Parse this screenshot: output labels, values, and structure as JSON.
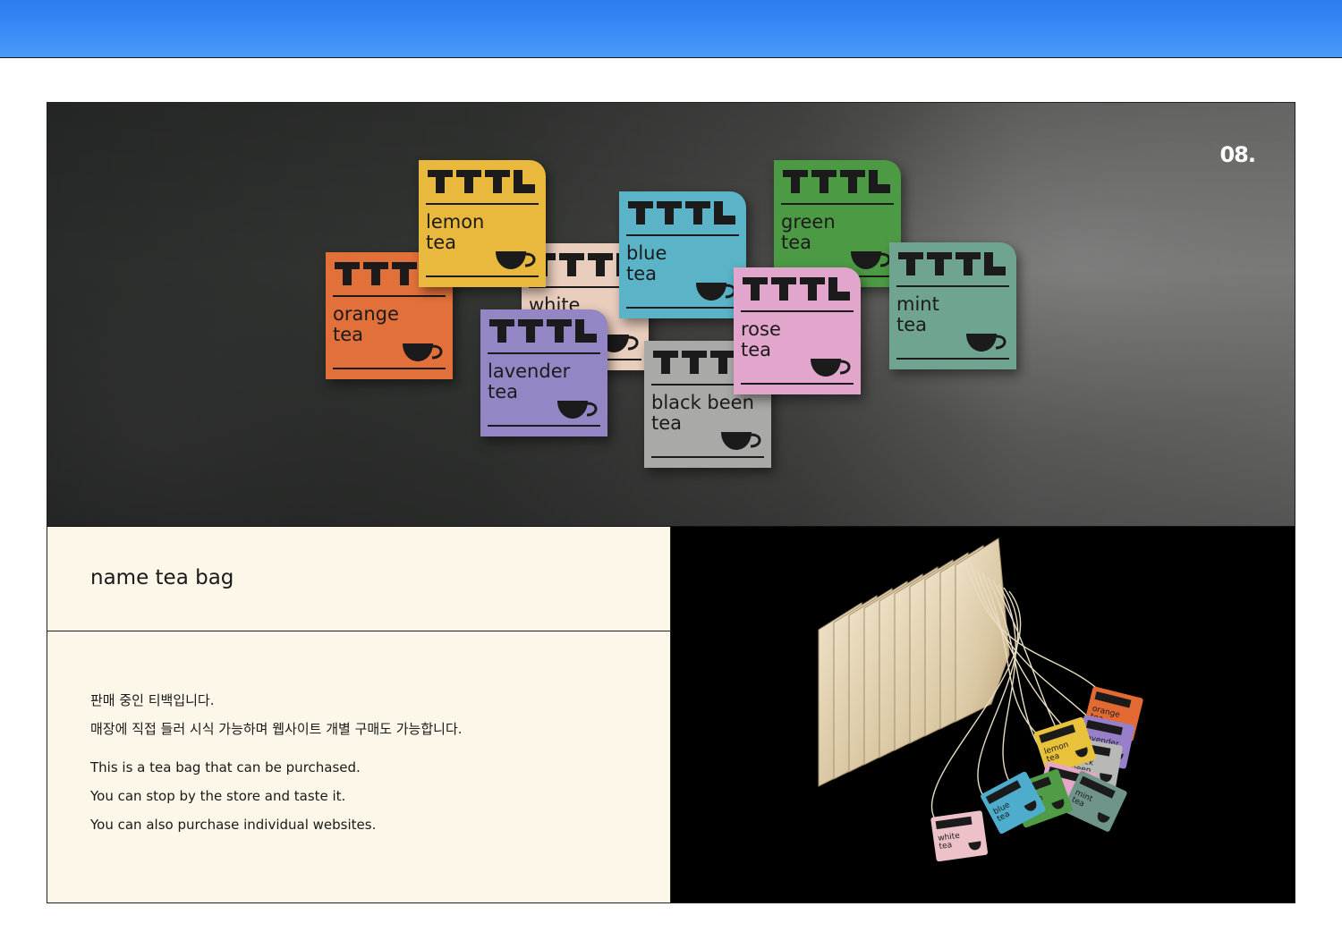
{
  "slide_number": "08.",
  "hero": {
    "tags": [
      {
        "name": "orange\ntea",
        "color": "#e2703b"
      },
      {
        "name": "lemon\ntea",
        "color": "#e8b93c"
      },
      {
        "name": "white",
        "color": "#e9cdbd"
      },
      {
        "name": "blue\ntea",
        "color": "#5bb3c8"
      },
      {
        "name": "lavender\ntea",
        "color": "#9486c4"
      },
      {
        "name": "black been\ntea",
        "color": "#a9aaa7"
      },
      {
        "name": "green\ntea",
        "color": "#4d9a45"
      },
      {
        "name": "rose\ntea",
        "color": "#e2a6cc"
      },
      {
        "name": "mint\ntea",
        "color": "#6fa490"
      }
    ]
  },
  "section_title": "name tea bag",
  "description": {
    "korean": [
      "판매 중인 티백입니다.",
      "매장에 직접 들러 시식 가능하며 웹사이트 개별 구매도 가능합니다."
    ],
    "english": [
      "This is a tea bag that can be purchased.",
      "You can stop by the store and taste it.",
      "You can also purchase individual websites."
    ]
  },
  "photo": {
    "tags": [
      "orange tea",
      "lavender tea",
      "black been tea",
      "lemon tea",
      "rose tea",
      "mint tea",
      "green tea",
      "blue tea",
      "white tea"
    ],
    "tag_colors": [
      "#e26a33",
      "#9780c9",
      "#b8b8b6",
      "#e8c23a",
      "#e6a7c6",
      "#6f958a",
      "#4f9b46",
      "#4eaccc",
      "#ecc1c8"
    ]
  }
}
